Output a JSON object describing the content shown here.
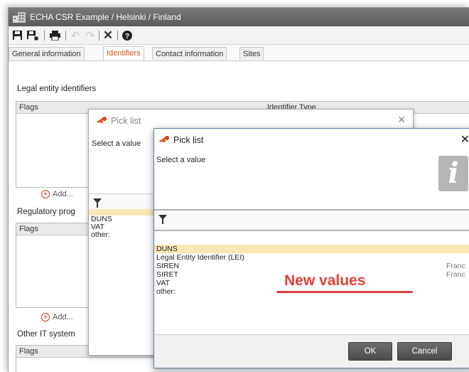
{
  "window": {
    "title": "ECHA CSR Example / Helsinki / Finland"
  },
  "toolbar": {
    "icons": [
      "save-icon",
      "save-as-icon",
      "print-icon",
      "undo-icon",
      "redo-icon",
      "delete-icon",
      "help-icon"
    ]
  },
  "tabs": [
    {
      "label": "General information",
      "active": false
    },
    {
      "label": "Identifiers",
      "active": true
    },
    {
      "label": "Contact information",
      "active": false
    },
    {
      "label": "Sites",
      "active": false
    }
  ],
  "sections": {
    "legal": {
      "label": "Legal entity identifiers",
      "col_flags": "Flags",
      "col_type": "Identifier Type",
      "add": "Add..."
    },
    "regulatory": {
      "label": "Regulatory prog",
      "col_flags": "Flags",
      "add": "Add..."
    },
    "other_it": {
      "label": "Other IT system",
      "col_flags": "Flags"
    }
  },
  "dialog_back": {
    "title": "Pick list",
    "prompt": "Select a value",
    "items": [
      "DUNS",
      "VAT",
      "other:"
    ]
  },
  "dialog_front": {
    "title": "Pick list",
    "prompt": "Select a value",
    "info_glyph": "i",
    "items": [
      {
        "label": "DUNS",
        "highlight": true,
        "right": ""
      },
      {
        "label": "Legal Entity Identifier (LEI)",
        "highlight": false,
        "right": ""
      },
      {
        "label": "SIREN",
        "highlight": false,
        "right": "Franc"
      },
      {
        "label": "SIRET",
        "highlight": false,
        "right": "Franc"
      },
      {
        "label": "VAT",
        "highlight": false,
        "right": ""
      },
      {
        "label": "other:",
        "highlight": false,
        "right": ""
      }
    ],
    "ok": "OK",
    "cancel": "Cancel"
  },
  "annotation": {
    "text": "New values",
    "color": "#e0413a"
  },
  "colors": {
    "accent_tab": "#d0531e",
    "highlight_row": "#fbe7b5",
    "titlebar": "#6a6a6a"
  }
}
